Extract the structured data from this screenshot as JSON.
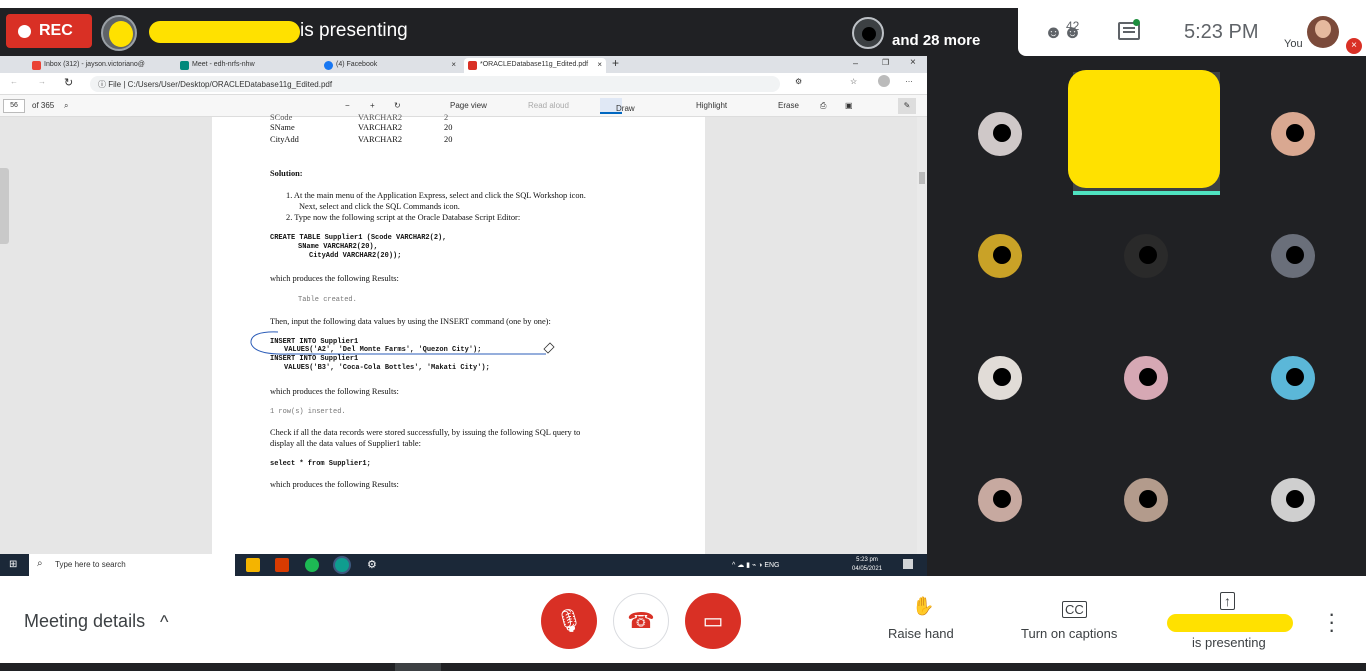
{
  "meeting": {
    "rec_label": "REC",
    "presenting_text": "is presenting",
    "more_text": "and 28 more",
    "participants_count": "42",
    "time": "5:23  PM",
    "you_label": "You"
  },
  "browser": {
    "tabs": [
      {
        "label": "Inbox (312) - jayson.victoriano@",
        "icon": "gmail-icon",
        "color": "#ea4335"
      },
      {
        "label": "Meet - edh-nrfs-nhw",
        "icon": "meet-icon",
        "color": "#00897b"
      },
      {
        "label": "(4) Facebook",
        "icon": "facebook-icon",
        "color": "#1877f2"
      },
      {
        "label": "*ORACLEDatabase11g_Edited.pdf",
        "icon": "pdf-icon",
        "color": "#d93025"
      }
    ],
    "address_prefix": "File",
    "address": "C:/Users/User/Desktop/ORACLEDatabase11g_Edited.pdf"
  },
  "pdf_toolbar": {
    "page_number": "56",
    "page_total": "of 365",
    "page_view": "Page view",
    "read_aloud": "Read aloud",
    "draw": "Draw",
    "highlight": "Highlight",
    "erase": "Erase"
  },
  "document": {
    "table_rows": [
      {
        "col": "SCode",
        "type": "VARCHAR2",
        "size": "2"
      },
      {
        "col": "SName",
        "type": "VARCHAR2",
        "size": "20"
      },
      {
        "col": "CityAdd",
        "type": "VARCHAR2",
        "size": "20"
      }
    ],
    "solution_heading": "Solution:",
    "step1": "1.   At the main menu of the Application Express, select and click the SQL Workshop icon.",
    "step1b": "Next, select and click the SQL Commands icon.",
    "step2": "2.   Type now the following script  at the Oracle Database Script Editor:",
    "code1": "CREATE TABLE Supplier1  (Scode VARCHAR2(2),",
    "code2": "SName VARCHAR2(20),",
    "code3": "CityAdd  VARCHAR2(20));",
    "produces1": "which produces the following Results:",
    "result1": "Table created.",
    "then_text": "Then, input the following data values by using the INSERT command (one by one):",
    "ins1": "INSERT INTO Supplier1",
    "ins2": "VALUES('A2', 'Del Monte Farms', 'Quezon City');",
    "ins3": "INSERT INTO Supplier1",
    "ins4": "VALUES('B3', 'Coca-Cola Bottles', 'Makati City');",
    "produces2": "which produces the following Results:",
    "result2": "1 row(s) inserted.",
    "check1": "Check if  all the data records were stored successfully, by issuing the following SQL query to",
    "check2": "display all the data values of Supplier1 table:",
    "select": "select * from Supplier1;",
    "produces3": "which produces the following Results:"
  },
  "taskbar": {
    "search_placeholder": "Type here to search",
    "lang": "ENG",
    "time": "5:23 pm",
    "date": "04/05/2021"
  },
  "controls": {
    "meeting_details": "Meeting details",
    "raise_hand": "Raise hand",
    "captions": "Turn on captions",
    "presenting": "is presenting"
  }
}
